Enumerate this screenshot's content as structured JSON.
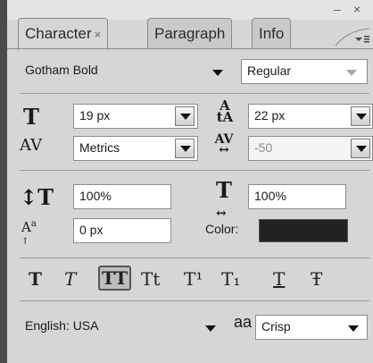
{
  "window": {
    "controls": {
      "minimize": "–",
      "close": "×"
    }
  },
  "tabs": [
    {
      "label": "Character",
      "close": "×",
      "active": true
    },
    {
      "label": "Paragraph",
      "active": false
    },
    {
      "label": "Info",
      "active": false
    }
  ],
  "font": {
    "family": "Gotham Bold",
    "style": "Regular"
  },
  "size": {
    "font_size": "19 px",
    "leading": "22 px"
  },
  "spacing": {
    "kerning": "Metrics",
    "tracking": "-50"
  },
  "scale": {
    "vertical": "100%",
    "horizontal": "100%"
  },
  "baseline": {
    "shift": "0 px"
  },
  "color": {
    "label": "Color:",
    "value": "#222222"
  },
  "formatting_buttons": [
    {
      "name": "faux-bold",
      "glyph": "T"
    },
    {
      "name": "faux-italic",
      "glyph": "T"
    },
    {
      "name": "all-caps",
      "glyph": "TT"
    },
    {
      "name": "small-caps",
      "glyph": "Tt"
    },
    {
      "name": "superscript",
      "glyph": "T¹"
    },
    {
      "name": "subscript",
      "glyph": "T₁"
    },
    {
      "name": "underline",
      "glyph": "T"
    },
    {
      "name": "strikethrough",
      "glyph": "Ŧ"
    }
  ],
  "language": {
    "value": "English: USA"
  },
  "antialias": {
    "icon_text": "aa",
    "value": "Crisp"
  }
}
